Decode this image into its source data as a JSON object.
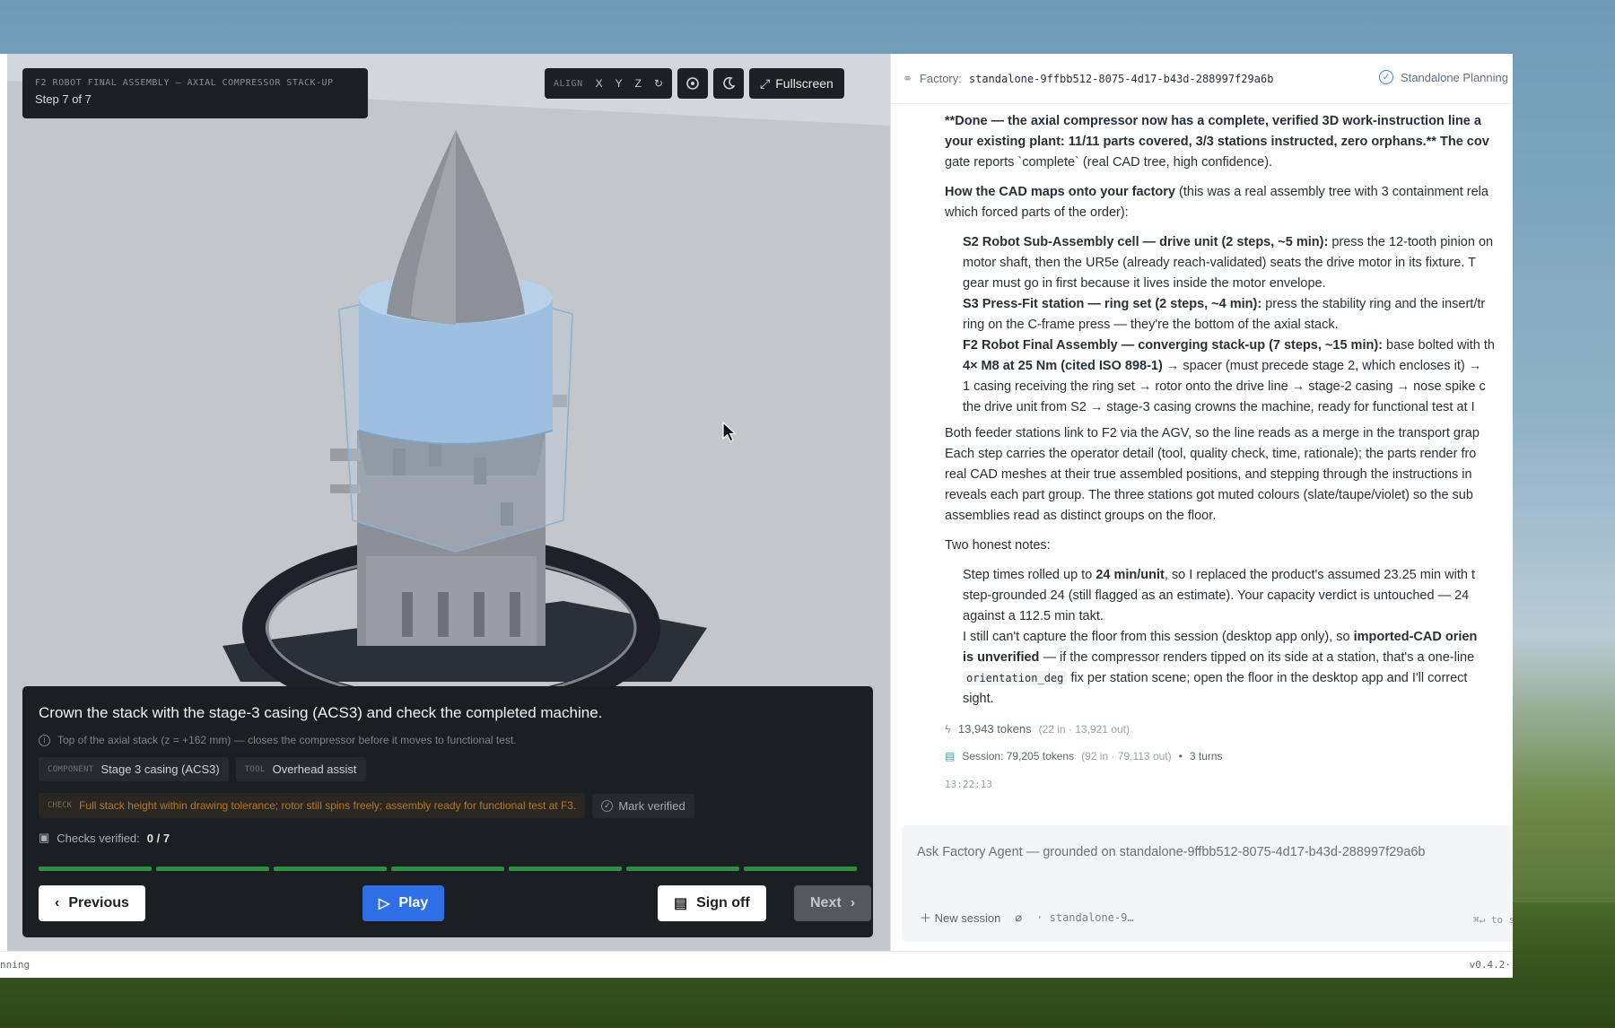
{
  "viewport": {
    "kicker": "F2 ROBOT FINAL ASSEMBLY — AXIAL COMPRESSOR STACK-UP",
    "step_label": "Step 7 of 7",
    "toolbar": {
      "align_label": "ALIGN",
      "x": "X",
      "y": "Y",
      "z": "Z",
      "reset_icon": "reset-icon",
      "fullscreen_label": "Fullscreen"
    }
  },
  "step": {
    "title": "Crown the stack with the stage-3 casing (ACS3) and check the completed machine.",
    "note": "Top of the axial stack (z = +162 mm) — closes the compressor before it moves to functional test.",
    "component_key": "COMPONENT",
    "component_value": "Stage 3 casing (ACS3)",
    "tool_key": "TOOL",
    "tool_value": "Overhead assist",
    "check_key": "CHECK",
    "check_text": "Full stack height within drawing tolerance; rotor still spins freely; assembly ready for functional test at F3.",
    "mark_label": "Mark verified",
    "verified_label": "Checks verified:",
    "verified_value": "0 / 7",
    "progress": {
      "completed_steps": 7,
      "total_steps": 7
    },
    "prev_label": "Previous",
    "play_label": "Play",
    "signoff_label": "Sign off",
    "next_label": "Next",
    "colors": {
      "accent": "#2f6fe6",
      "progress": "#2f9a46",
      "warning": "#b8781f"
    }
  },
  "agent": {
    "factory_label": "Factory:",
    "factory_id": "standalone-9ffbb512-8075-4d17-b43d-288997f29a6b",
    "planning_label": "Standalone Planning",
    "message": {
      "p1_l1": "**Done — the axial compressor now has a complete, verified 3D work-instruction line a",
      "p1_l2": "your existing plant: 11/11 parts covered, 3/3 stations instructed, zero orphans.** The cov",
      "p1_l3": "gate reports `complete` (real CAD tree, high confidence).",
      "p2_b": "How the CAD maps onto your factory",
      "p2_l1": " (this was a real assembly tree with 3 containment rela",
      "p2_l2": "which forced parts of the order):",
      "s2_b": "S2 Robot Sub-Assembly cell — drive unit (2 steps, ~5 min):",
      "s2_l1": " press the 12-tooth pinion on",
      "s2_l2": "motor shaft, then the UR5e (already reach-validated) seats the drive motor in its fixture. T",
      "s2_l3": "gear must go in first because it lives inside the motor envelope.",
      "s3_b": "S3 Press-Fit station — ring set (2 steps, ~4 min):",
      "s3_l1": " press the stability ring and the insert/tr",
      "s3_l2": "ring on the C-frame press — they're the bottom of the axial stack.",
      "f2_b": "F2 Robot Final Assembly — converging stack-up (7 steps, ~15 min):",
      "f2_l1": " base bolted with th",
      "f2_b2": "4× M8 at 25 Nm (cited ISO 898-1)",
      "f2_l2": " → spacer (must precede stage 2, which encloses it) →",
      "f2_l3": "1 casing receiving the ring set → rotor onto the drive line → stage-2 casing → nose spike c",
      "f2_l4": "the drive unit from S2 → stage-3 casing crowns the machine, ready for functional test at I",
      "p3_l1": "Both feeder stations link to F2 via the AGV, so the line reads as a merge in the transport grap",
      "p3_l2": "Each step carries the operator detail (tool, quality check, time, rationale); the parts render fro",
      "p3_l3": "real CAD meshes at their true assembled positions, and stepping through the instructions in",
      "p3_l4": "reveals each part group. The three stations got muted colours (slate/taupe/violet) so the sub",
      "p3_l5": "assemblies read as distinct groups on the floor.",
      "p4": "Two honest notes:",
      "n1_l1a": "Step times rolled up to ",
      "n1_b": "24 min/unit",
      "n1_l1b": ", so I replaced the product's assumed 23.25 min with t",
      "n1_l2": "step-grounded 24 (still flagged as an estimate). Your capacity verdict is untouched — 24",
      "n1_l3": "against a 112.5 min takt.",
      "n2_l1a": "I still can't capture the floor from this session (desktop app only), so ",
      "n2_b1": "imported-CAD orien",
      "n2_b2": "is unverified",
      "n2_l2": " — if the compressor renders tipped on its side at a station, that's a one-line",
      "n2_code": "orientation_deg",
      "n2_l3": " fix per station scene; open the floor in the desktop app and I'll correct",
      "n2_l4": "sight."
    },
    "tokens": "13,943 tokens",
    "tokens_detail": "(22 in · 13,921 out)",
    "session": "Session: 79,205 tokens",
    "session_detail": "(92 in · 79,113 out)",
    "turns": "3 turns",
    "timestamp": "13:22:13",
    "input_placeholder": "Ask Factory Agent — grounded on standalone-9ffbb512-8075-4d17-b43d-288997f29a6b",
    "new_session": "New session",
    "context_chip": "· standalone-9…",
    "send_hint": "⌘↵ to se"
  },
  "status": {
    "left": "nning",
    "version": "v0.4.2·"
  }
}
